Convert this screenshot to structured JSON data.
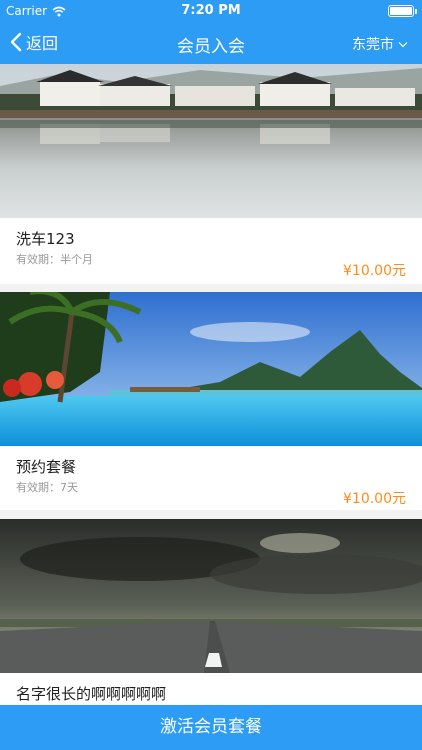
{
  "status_bar": {
    "carrier": "Carrier",
    "time": "7:20 PM",
    "battery_level": 1.0
  },
  "nav": {
    "back_label": "返回",
    "title": "会员入会",
    "city": "东莞市"
  },
  "packages": [
    {
      "name": "洗车123",
      "validity": "有效期：半个月",
      "price": "¥10.00元",
      "image": "hui-village-lake-reflection"
    },
    {
      "name": "预约套餐",
      "validity": "有效期：7天",
      "price": "¥10.00元",
      "image": "tropical-beach-pool-mountain"
    },
    {
      "name": "名字很长的啊啊啊啊啊",
      "validity": "",
      "price": "",
      "image": "stormy-sky-road"
    }
  ],
  "footer": {
    "activate_label": "激活会员套餐"
  },
  "colors": {
    "primary": "#2c9cf4",
    "price": "#ff8c1a",
    "muted": "#999999"
  },
  "icons": [
    "wifi-icon",
    "battery-icon",
    "back-chevron-icon",
    "dropdown-chevron-icon"
  ]
}
